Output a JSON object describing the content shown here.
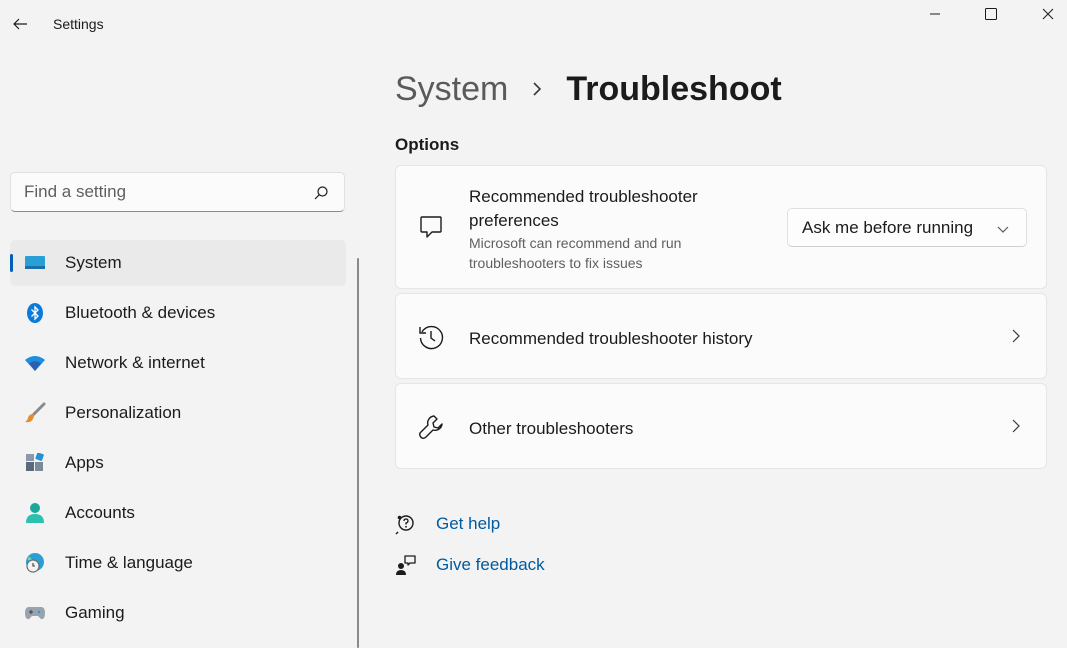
{
  "window": {
    "title": "Settings",
    "back_icon": "back-arrow-icon",
    "controls": [
      "minimize-icon",
      "maximize-icon",
      "close-icon"
    ]
  },
  "search": {
    "placeholder": "Find a setting",
    "value": ""
  },
  "sidebar": {
    "items": [
      {
        "label": "System",
        "icon": "system-monitor-icon",
        "active": true
      },
      {
        "label": "Bluetooth & devices",
        "icon": "bluetooth-icon"
      },
      {
        "label": "Network & internet",
        "icon": "wifi-icon"
      },
      {
        "label": "Personalization",
        "icon": "paintbrush-icon"
      },
      {
        "label": "Apps",
        "icon": "apps-icon"
      },
      {
        "label": "Accounts",
        "icon": "person-icon"
      },
      {
        "label": "Time & language",
        "icon": "globe-clock-icon"
      },
      {
        "label": "Gaming",
        "icon": "gamepad-icon"
      }
    ]
  },
  "header": {
    "parent": "System",
    "current": "Troubleshoot"
  },
  "main": {
    "section_title": "Options",
    "cards": [
      {
        "title": "Recommended troubleshooter preferences",
        "description": "Microsoft can recommend and run troubleshooters to fix issues",
        "icon": "chat-bubble-icon",
        "dropdown_value": "Ask me before running"
      },
      {
        "title": "Recommended troubleshooter history",
        "icon": "history-icon"
      },
      {
        "title": "Other troubleshooters",
        "icon": "wrench-icon"
      }
    ],
    "links": [
      {
        "label": "Get help",
        "icon": "help-icon"
      },
      {
        "label": "Give feedback",
        "icon": "feedback-icon"
      }
    ]
  },
  "colors": {
    "accent": "#005fb8",
    "link": "#005a9e",
    "background": "#f3f3f3",
    "card": "#fbfbfb"
  }
}
